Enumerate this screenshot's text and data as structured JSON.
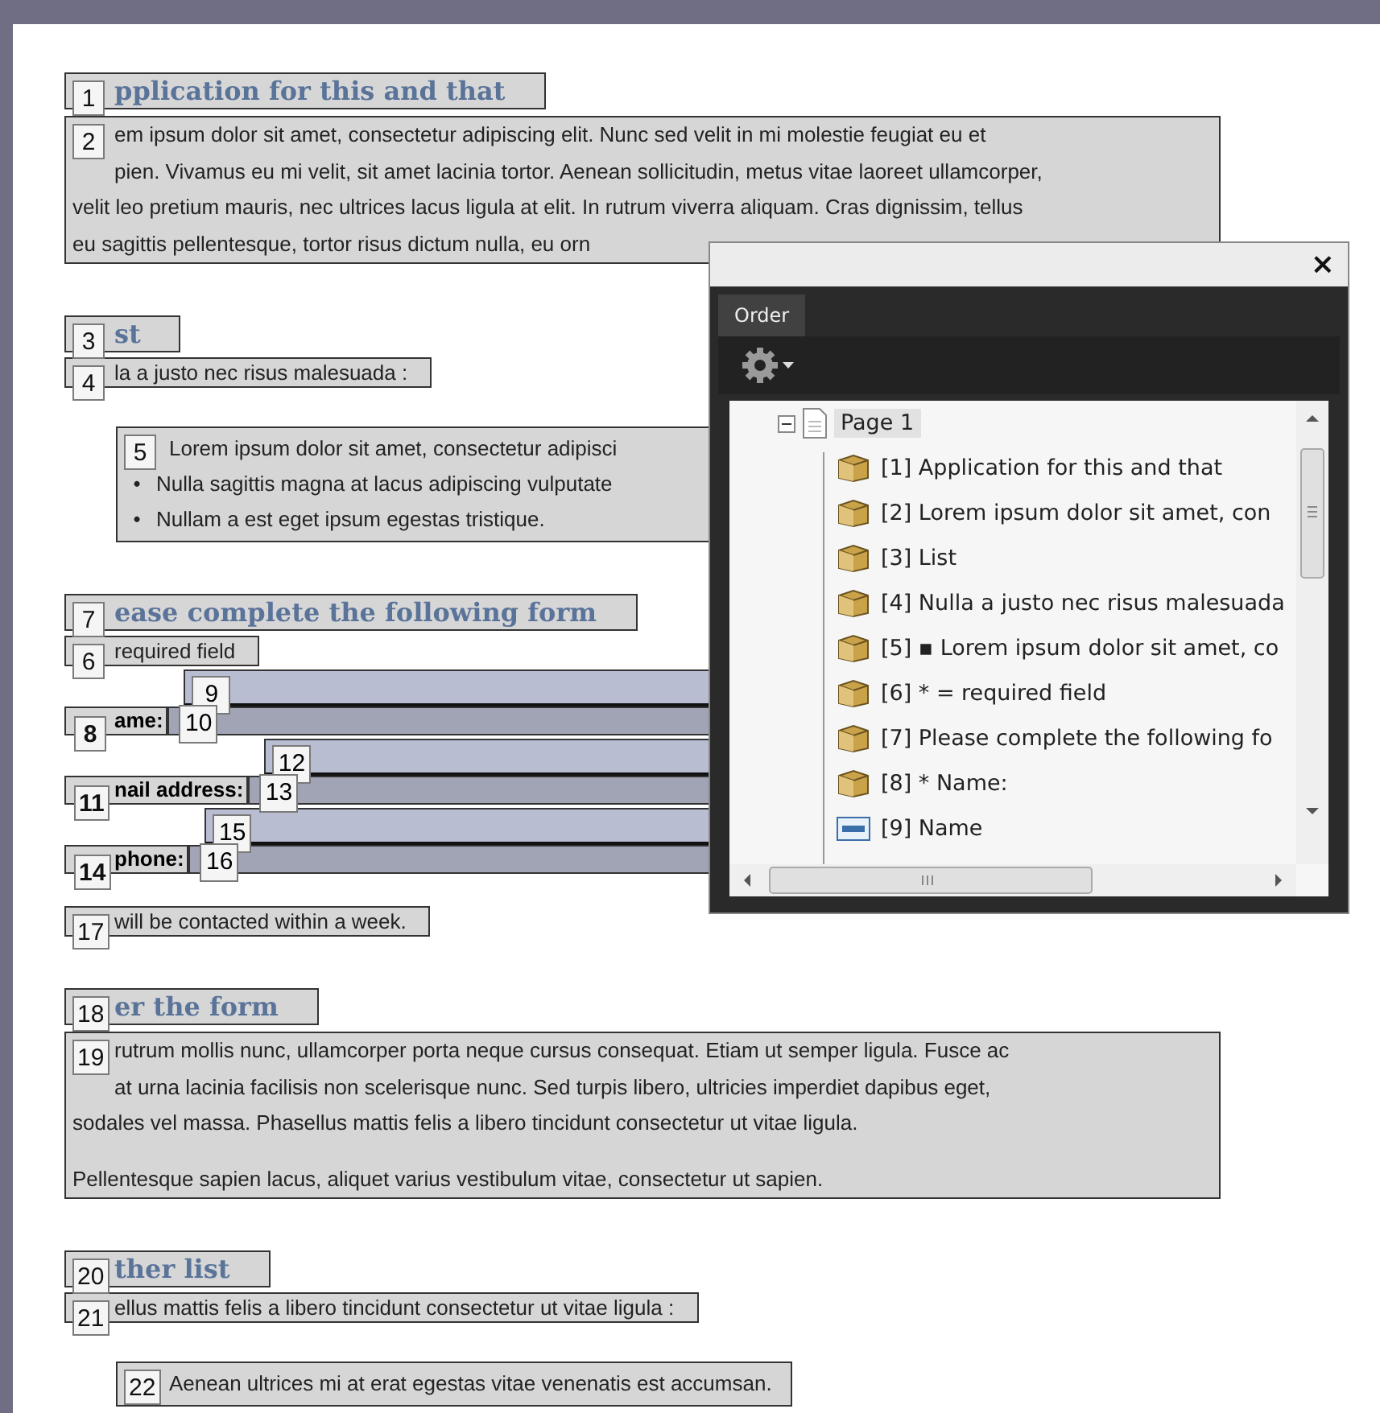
{
  "document": {
    "blocks": [
      {
        "kind": "heading",
        "badge": "1",
        "text": "pplication for this and that"
      },
      {
        "kind": "paragraph",
        "badge": "2",
        "paragraphs": [
          [
            "em ipsum dolor sit amet, consectetur adipiscing elit. Nunc sed velit in mi molestie feugiat eu et",
            "pien. Vivamus eu mi velit, sit amet lacinia tortor. Aenean sollicitudin, metus vitae laoreet ullamcorper,",
            "velit leo pretium mauris, nec ultrices lacus ligula at elit. In rutrum viverra aliquam. Cras dignissim, tellus",
            "eu sagittis pellentesque, tortor risus dictum nulla, eu orn"
          ]
        ]
      },
      {
        "kind": "heading",
        "badge": "3",
        "text": "st"
      },
      {
        "kind": "line",
        "badge": "4",
        "text": "la a justo nec risus malesuada :"
      },
      {
        "kind": "list",
        "badge": "5",
        "items": [
          {
            "text": "Lorem ipsum dolor sit amet, consectetur adipisci"
          },
          {
            "bullet": "•",
            "text": "Nulla sagittis magna at lacus adipiscing vulputate"
          },
          {
            "bullet": "•",
            "text": "Nullam a est eget ipsum egestas tristique."
          }
        ]
      },
      {
        "kind": "heading",
        "badge": "7",
        "text": "ease complete the following form"
      },
      {
        "kind": "line",
        "badge": "6",
        "text": "required field"
      },
      {
        "kind": "field",
        "badge": "8",
        "label": "ame:",
        "field_badges": [
          "9",
          "10"
        ]
      },
      {
        "kind": "field",
        "badge": "11",
        "label": "nail address:",
        "field_badges": [
          "12",
          "13"
        ]
      },
      {
        "kind": "field",
        "badge": "14",
        "label": "phone:",
        "field_badges": [
          "15",
          "16"
        ]
      },
      {
        "kind": "line",
        "badge": "17",
        "text": "will be contacted within a week."
      },
      {
        "kind": "heading",
        "badge": "18",
        "text": "er the form"
      },
      {
        "kind": "paragraph",
        "badge": "19",
        "paragraphs": [
          [
            "rutrum mollis nunc, ullamcorper porta neque cursus consequat. Etiam ut semper ligula. Fusce ac",
            "at urna lacinia facilisis non scelerisque nunc. Sed turpis libero, ultricies imperdiet dapibus eget,",
            "sodales vel massa. Phasellus mattis felis a libero tincidunt consectetur ut vitae ligula."
          ],
          [
            "Pellentesque sapien lacus, aliquet varius vestibulum vitae, consectetur ut sapien."
          ]
        ]
      },
      {
        "kind": "heading",
        "badge": "20",
        "text": "ther list"
      },
      {
        "kind": "line",
        "badge": "21",
        "text": "ellus mattis felis a libero tincidunt consectetur ut vitae ligula :"
      },
      {
        "kind": "list",
        "badge": "22",
        "items": [
          {
            "text": "Aenean ultrices mi at erat egestas vitae venenatis est accumsan."
          }
        ]
      }
    ]
  },
  "order_panel": {
    "close": "×",
    "tabs": [
      {
        "label": "Order",
        "selected": true
      }
    ],
    "tree": {
      "label": "Page 1",
      "expanded": true,
      "selected": true,
      "children": [
        {
          "kind": "tag",
          "label": "[1]  Application for this and that"
        },
        {
          "kind": "tag",
          "label": "[2]  Lorem ipsum dolor sit amet, con"
        },
        {
          "kind": "tag",
          "label": "[3]  List"
        },
        {
          "kind": "tag",
          "label": "[4]  Nulla a justo nec risus malesuada"
        },
        {
          "kind": "tag",
          "label": "[5]  ▪ Lorem ipsum dolor sit amet, co"
        },
        {
          "kind": "tag",
          "label": "[6]  * = required field"
        },
        {
          "kind": "tag",
          "label": "[7]  Please complete the following fo"
        },
        {
          "kind": "tag",
          "label": "[8]  * Name:"
        },
        {
          "kind": "form-field",
          "label": "[9]  Name"
        }
      ]
    }
  }
}
